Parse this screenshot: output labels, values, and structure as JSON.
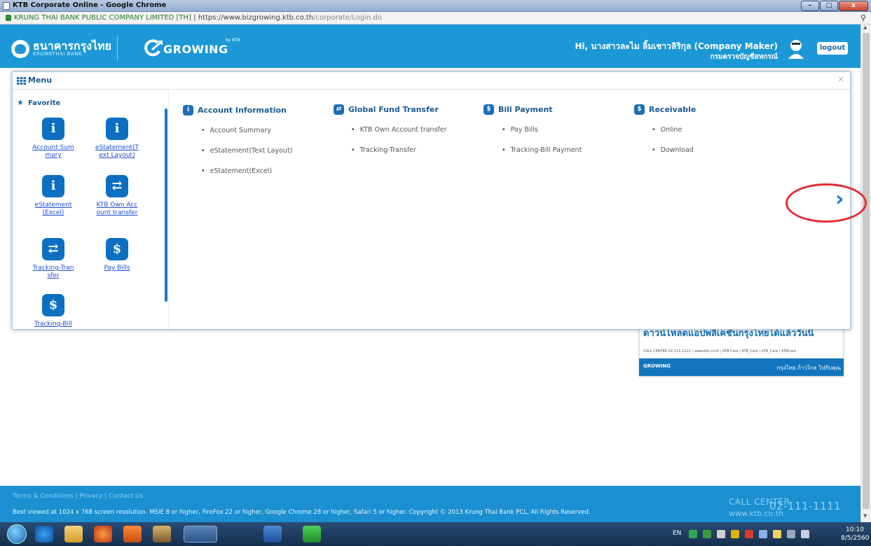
{
  "window": {
    "title": "KTB Corporate Online - Google Chrome",
    "min_icon": "minimize-icon",
    "max_icon": "maximize-icon",
    "close_glyph": "x"
  },
  "address_bar": {
    "site_identity": "KRUNG THAI BANK PUBLIC COMPANY LIMITED [TH]",
    "separator": "|",
    "url_base": "https://www.bizgrowing.ktb.co.th",
    "url_path": "/corporate/Login.do"
  },
  "header": {
    "bank_name_thai": "ธนาคารกรุงไทย",
    "bank_name_en": "KRUNGTHAI BANK",
    "growing_text": "GROWING",
    "growing_by": "by KTB",
    "greeting": "Hi, นางสาวละไม ลิ้มเชาวลิริกุล (Company Maker)",
    "department": "กรมตรวจบัญชีสหกรณ์",
    "logout_label": "logout"
  },
  "menu": {
    "title": "Menu",
    "close_glyph": "×",
    "favorite": {
      "title": "Favorite",
      "items": [
        {
          "label": "Account Summary",
          "icon_glyph": "i",
          "icon": "info-icon"
        },
        {
          "label": "eStatement(Text Layout)",
          "icon_glyph": "i",
          "icon": "info-icon"
        },
        {
          "label": "eStatement(Excel)",
          "icon_glyph": "i",
          "icon": "info-icon"
        },
        {
          "label": "KTB Own Account transfer",
          "icon_glyph": "⇄",
          "icon": "transfer-icon"
        },
        {
          "label": "Tracking-Transfer",
          "icon_glyph": "⇄",
          "icon": "transfer-icon"
        },
        {
          "label": "Pay Bills",
          "icon_glyph": "$",
          "icon": "dollar-icon"
        },
        {
          "label": "Tracking-Bill",
          "icon_glyph": "$",
          "icon": "dollar-icon"
        }
      ]
    },
    "categories": [
      {
        "title": "Account Information",
        "icon_glyph": "i",
        "items": [
          "Account Summary",
          "eStatement(Text Layout)",
          "eStatement(Excel)"
        ]
      },
      {
        "title": "Global Fund Transfer",
        "icon_glyph": "⇄",
        "items": [
          "KTB Own Account transfer",
          "Tracking-Transfer"
        ]
      },
      {
        "title": "Bill Payment",
        "icon_glyph": "$",
        "items": [
          "Pay Bills",
          "Tracking-Bill Payment"
        ]
      },
      {
        "title": "Receivable",
        "icon_glyph": "$",
        "items": [
          "Online",
          "Download"
        ]
      }
    ],
    "next_glyph": "›"
  },
  "banner": {
    "title": "ดาวน์โหลดแอปพลิเคชันกรุงไทยได้แล้ววันนี้",
    "links": "CALL CENTER 02-111-1111 | www.ktb.co.th | KTB Care | KTB_Care | KTB_Care | KTBCare",
    "logo": "GROWING",
    "slogan": "กรุงไทย ก้าวไกล ไปกับคุณ"
  },
  "footer": {
    "links": [
      "Terms & Conditions",
      "Privacy",
      "Contact Us"
    ],
    "link_sep": "|",
    "copyright": "Best viewed at 1024 x 768 screen resolution. MSIE 8 or higher, FireFox 22 or higher, Google Chrome 28 or higher, Safari 5 or higher. Copyright © 2013 Krung Thai Bank PCL, All Rights Reserved.",
    "call_center_label": "CALL CENTER",
    "call_center_number": "02-111-1111",
    "website": "www.ktb.co.th"
  },
  "taskbar": {
    "language": "EN",
    "time": "10:10",
    "date": "8/5/2560"
  },
  "colors": {
    "brand_blue": "#1c98d6",
    "menu_accent": "#1c6fb5",
    "annotation_red": "#e32c36"
  }
}
